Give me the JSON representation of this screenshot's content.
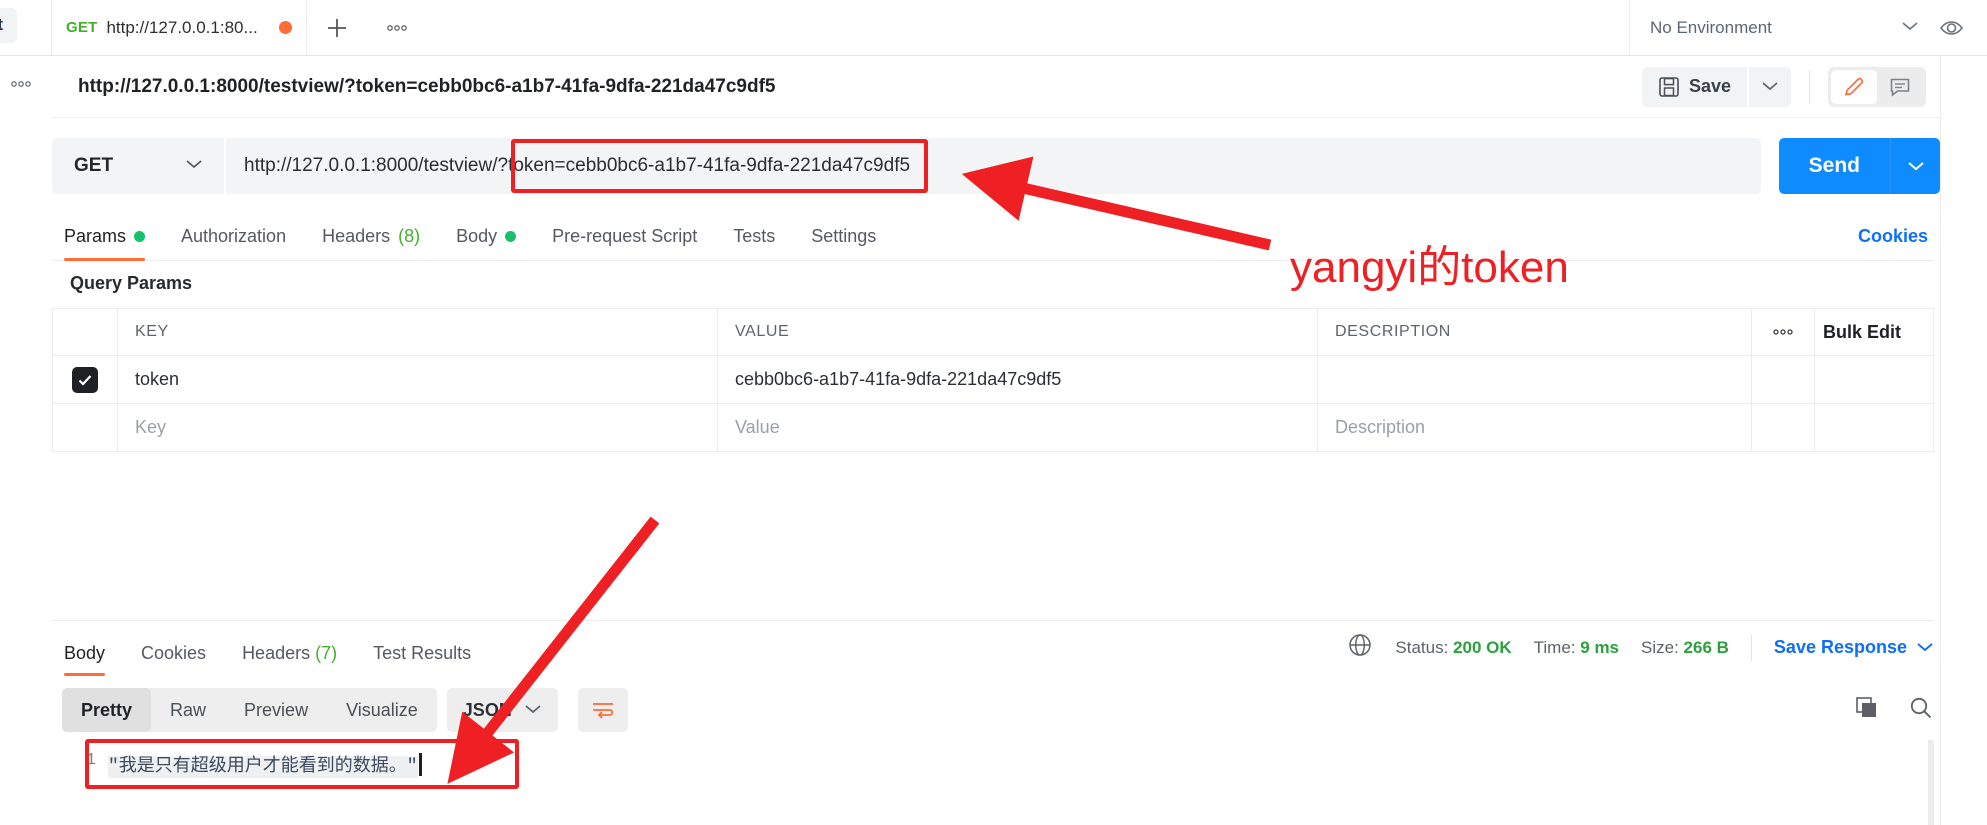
{
  "window": {
    "sidebar_clipped_label": "port",
    "sidebar_more_icon": "ellipsis-icon"
  },
  "tabbar": {
    "request_tab": {
      "method": "GET",
      "name": "http://127.0.0.1:80...",
      "unsaved_indicator": "unsaved-dot"
    },
    "new_tab_icon": "plus-icon",
    "more_tabs_icon": "ellipsis-icon",
    "environment": {
      "selected": "No Environment",
      "chevron": "chevron-down-icon"
    },
    "eye_icon": "eye-icon"
  },
  "request_header": {
    "title": "http://127.0.0.1:8000/testview/?token=cebb0bc6-a1b7-41fa-9dfa-221da47c9df5",
    "save_label": "Save",
    "save_icon": "floppy-disk-icon",
    "save_caret_icon": "chevron-down-icon",
    "edit_icon": "pencil-icon",
    "comment_icon": "comment-icon",
    "code_icon": "code-brackets-icon",
    "more_icon": "ellipsis-icon"
  },
  "url_bar": {
    "method": "GET",
    "method_chevron": "chevron-down-icon",
    "url_prefix": "http://127.0.0.1:8000/testview/?",
    "url_query": "token=cebb0bc6-a1b7-41fa-9dfa-221da47c9df5",
    "send_label": "Send",
    "send_caret_icon": "chevron-down-icon"
  },
  "request_tabs": [
    {
      "label": "Params",
      "dot": true,
      "active": true
    },
    {
      "label": "Authorization",
      "dot": false,
      "active": false
    },
    {
      "label": "Headers",
      "count": "(8)",
      "active": false
    },
    {
      "label": "Body",
      "dot": true,
      "active": false
    },
    {
      "label": "Pre-request Script",
      "active": false
    },
    {
      "label": "Tests",
      "active": false
    },
    {
      "label": "Settings",
      "active": false
    }
  ],
  "cookies_link": "Cookies",
  "query_params": {
    "section_title": "Query Params",
    "columns": [
      "KEY",
      "VALUE",
      "DESCRIPTION"
    ],
    "row_more_icon": "ellipsis-icon",
    "bulk_edit_label": "Bulk Edit",
    "rows": [
      {
        "enabled": true,
        "key": "token",
        "value": "cebb0bc6-a1b7-41fa-9dfa-221da47c9df5",
        "description": ""
      }
    ],
    "placeholders": {
      "key": "Key",
      "value": "Value",
      "description": "Description"
    }
  },
  "response": {
    "tabs": [
      {
        "label": "Body",
        "active": true
      },
      {
        "label": "Cookies",
        "active": false
      },
      {
        "label": "Headers",
        "count": "(7)",
        "active": false
      },
      {
        "label": "Test Results",
        "active": false
      }
    ],
    "globe_icon": "globe-icon",
    "status_label": "Status:",
    "status_value": "200 OK",
    "time_label": "Time:",
    "time_value": "9 ms",
    "size_label": "Size:",
    "size_value": "266 B",
    "save_response_label": "Save Response",
    "save_response_caret": "chevron-down-icon",
    "view_modes": [
      {
        "label": "Pretty",
        "active": true
      },
      {
        "label": "Raw",
        "active": false
      },
      {
        "label": "Preview",
        "active": false
      },
      {
        "label": "Visualize",
        "active": false
      }
    ],
    "language": "JSON",
    "language_chevron": "chevron-down-icon",
    "wrap_icon": "word-wrap-icon",
    "copy_icon": "copy-icon",
    "search_icon": "search-icon",
    "body": {
      "line_number": "1",
      "content": "\"我是只有超级用户才能看到的数据。\"",
      "caret": true
    }
  },
  "annotations": {
    "token_note": "yangyi的token",
    "color": "#ee2024"
  },
  "colors": {
    "accent_orange": "#ff6c37",
    "send_blue": "#0d8bff",
    "link_blue": "#0d6efd",
    "status_green": "#2aa13c",
    "annotation_red": "#ee2024"
  }
}
